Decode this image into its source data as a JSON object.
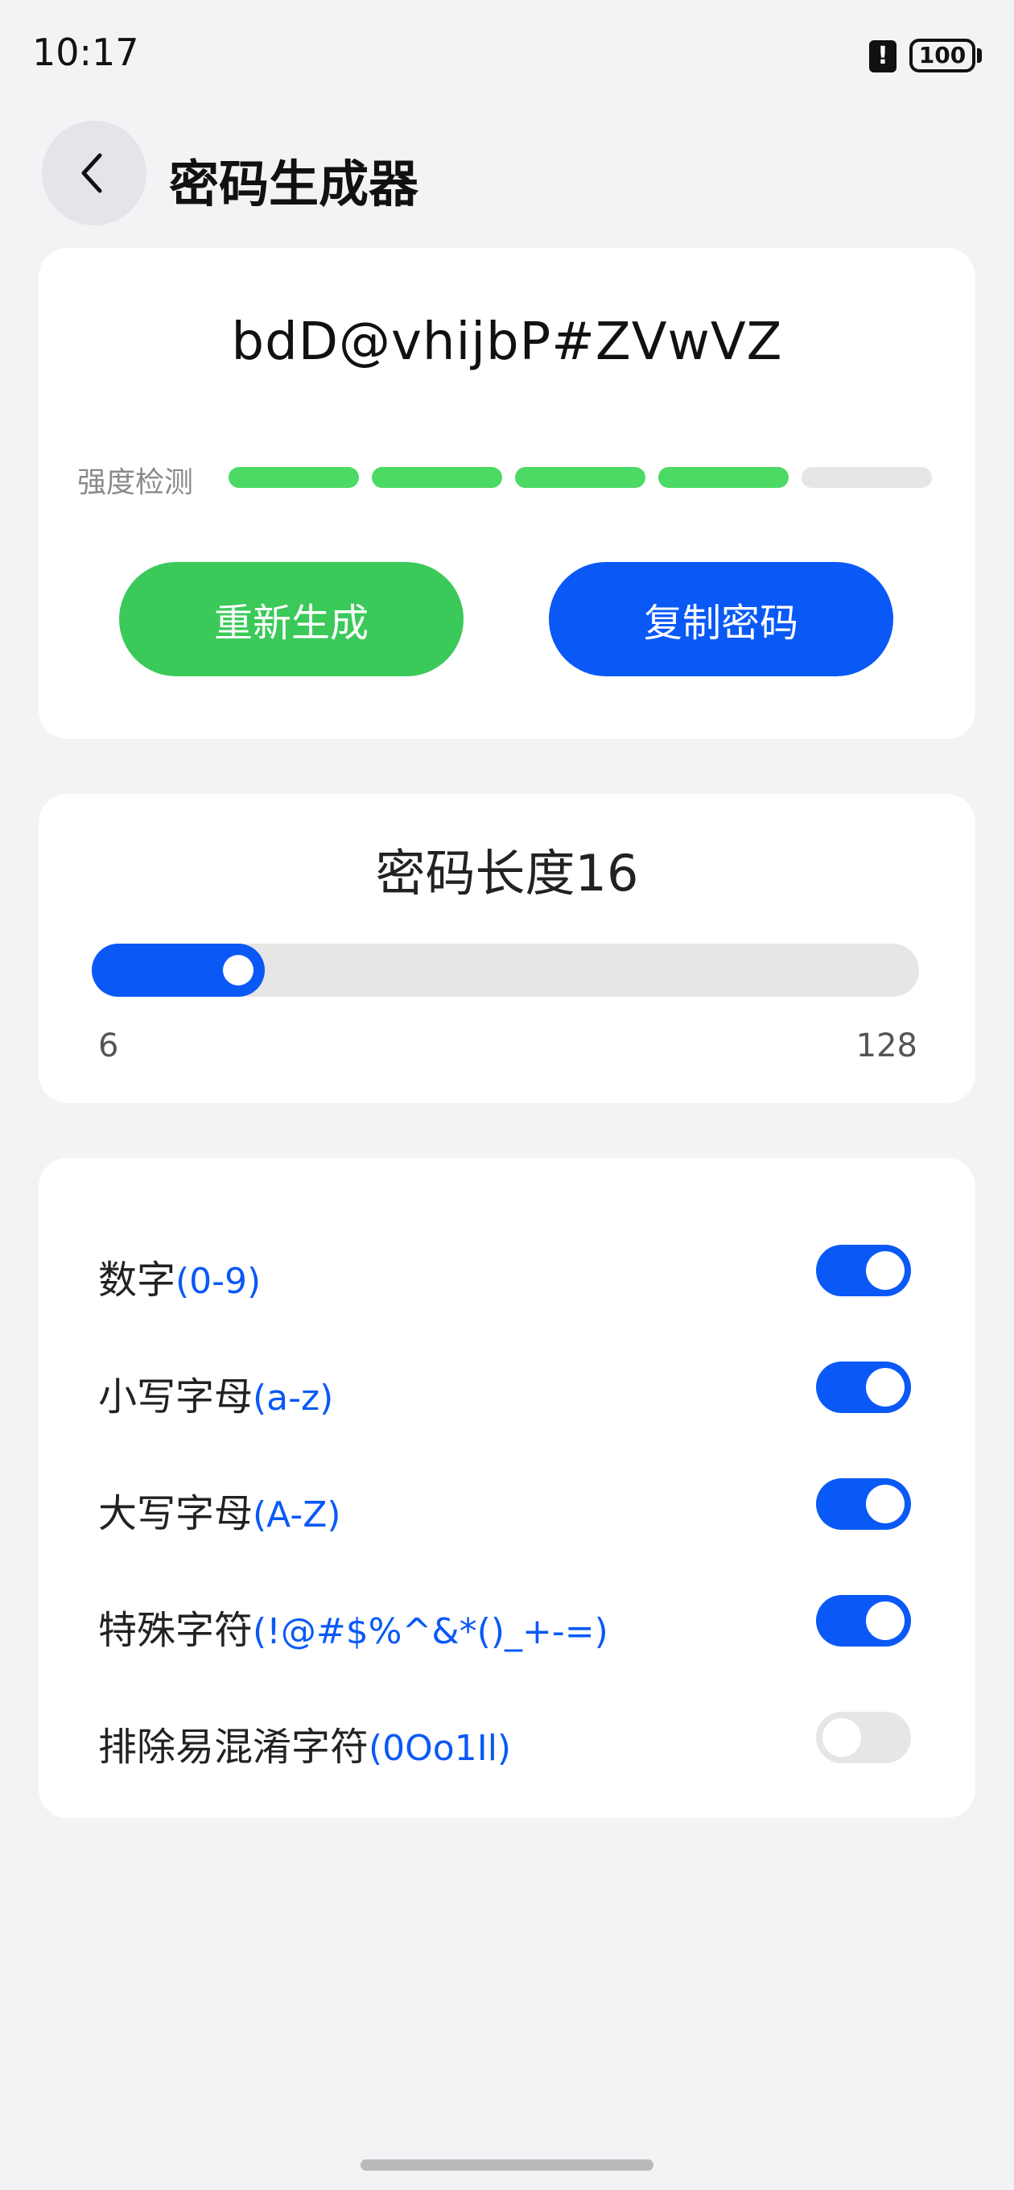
{
  "status": {
    "time": "10:17",
    "alert_glyph": "!",
    "battery": "100"
  },
  "header": {
    "title": "密码生成器",
    "back_icon": "chevron-left-icon"
  },
  "password": {
    "value": "bdD@vhijbP#ZVwVZ",
    "strength_label": "强度检测",
    "strength_level": 4,
    "strength_total": 5,
    "strength_color": "#4cd964",
    "strength_empty_color": "#e6e6e6",
    "regenerate_label": "重新生成",
    "copy_label": "复制密码"
  },
  "length": {
    "title_prefix": "密码长度",
    "value": "16",
    "min": "6",
    "max": "128"
  },
  "options": [
    {
      "label": "数字",
      "hint": "(0-9)",
      "enabled": true
    },
    {
      "label": "小写字母",
      "hint": "(a-z)",
      "enabled": true
    },
    {
      "label": "大写字母",
      "hint": "(A-Z)",
      "enabled": true
    },
    {
      "label": "特殊字符",
      "hint": "(!@#$%^&*()_+-=)",
      "enabled": true
    },
    {
      "label": "排除易混淆字符",
      "hint": "(0Oo1Il)",
      "enabled": false
    }
  ],
  "colors": {
    "accent": "#0a59f7",
    "success": "#3bc95a",
    "background": "#f1f3f5"
  }
}
